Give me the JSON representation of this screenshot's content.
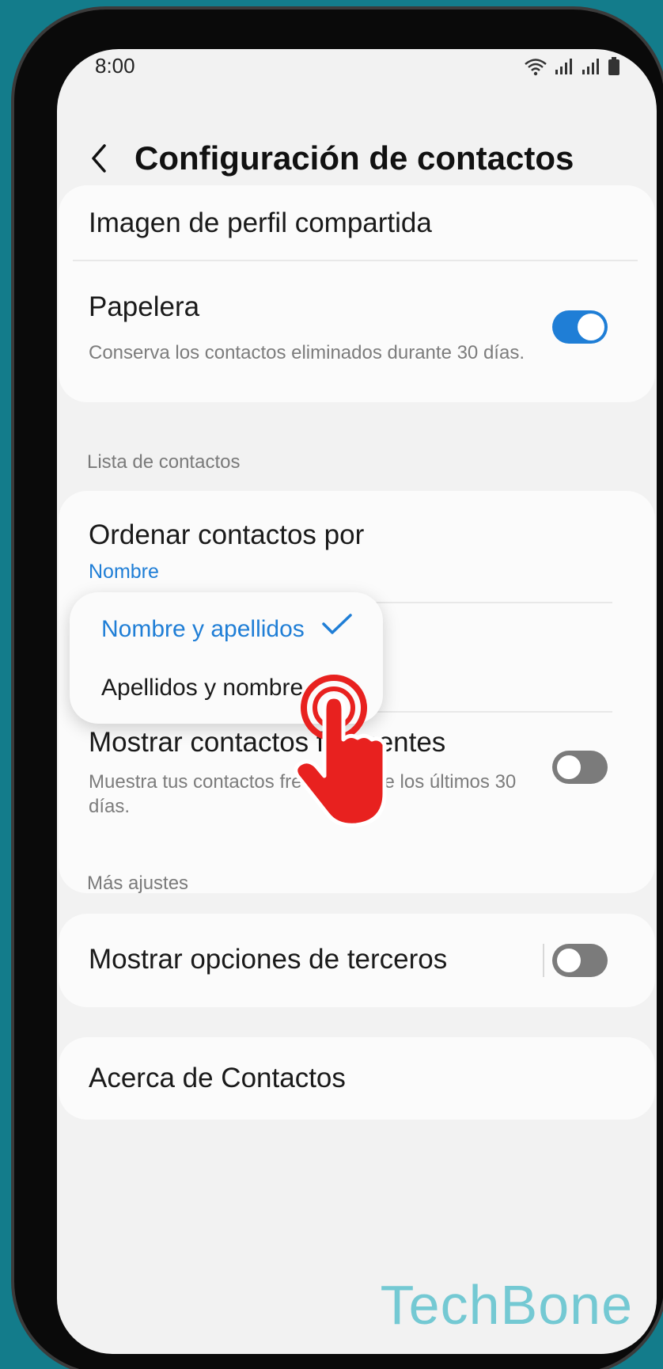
{
  "status": {
    "time": "8:00"
  },
  "header": {
    "title": "Configuración de contactos"
  },
  "profile": {
    "label": "Imagen de perfil compartida"
  },
  "trash": {
    "label": "Papelera",
    "description": "Conserva los contactos eliminados durante 30 días.",
    "enabled": true
  },
  "contact_list": {
    "section_title": "Lista de contactos"
  },
  "sort": {
    "label": "Ordenar contactos por",
    "value": "Nombre"
  },
  "sort_menu": {
    "options": [
      {
        "label": "Nombre y apellidos",
        "selected": true
      },
      {
        "label": "Apellidos y nombre",
        "selected": false
      }
    ]
  },
  "frequent": {
    "label": "Mostrar contactos frecuentes",
    "description": "Muestra tus contactos frecuentes de los últimos 30 días.",
    "enabled": false
  },
  "more": {
    "section_title": "Más ajustes"
  },
  "third_party": {
    "label": "Mostrar opciones de terceros",
    "enabled": false
  },
  "about": {
    "label": "Acerca de Contactos"
  },
  "watermark": {
    "text": "TechBone"
  },
  "colors": {
    "accent": "#1f7ed6",
    "background": "#137c8b",
    "touch_hand": "#e8211f"
  },
  "icons": [
    "wifi-icon",
    "signal-icon",
    "battery-icon",
    "back-arrow-icon",
    "checkmark-icon",
    "tap-hand-icon"
  ]
}
